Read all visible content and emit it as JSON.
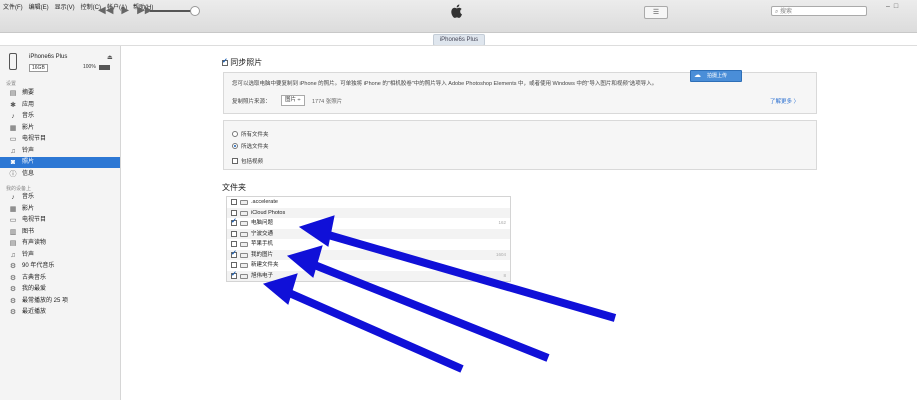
{
  "menu": [
    "文件(F)",
    "编辑(E)",
    "显示(V)",
    "控制(C)",
    "帐户(A)",
    "帮助(H)"
  ],
  "search": {
    "placeholder": "搜索"
  },
  "device_tab": "iPhone6s Plus",
  "device": {
    "name": "iPhone6s Plus",
    "capacity": "16GB",
    "battery": "100%"
  },
  "sidebar": {
    "section1": "设置",
    "items1": [
      {
        "label": "摘要",
        "icon": "summary-icon"
      },
      {
        "label": "应用",
        "icon": "apps-icon"
      },
      {
        "label": "音乐",
        "icon": "music-icon"
      },
      {
        "label": "影片",
        "icon": "movies-icon"
      },
      {
        "label": "电视节目",
        "icon": "tv-icon"
      },
      {
        "label": "铃声",
        "icon": "bell-icon"
      },
      {
        "label": "照片",
        "icon": "camera-icon",
        "selected": true
      },
      {
        "label": "信息",
        "icon": "info-icon"
      }
    ],
    "section2": "我的设备上",
    "items2": [
      {
        "label": "音乐",
        "icon": "music-icon"
      },
      {
        "label": "影片",
        "icon": "movies-icon"
      },
      {
        "label": "电视节目",
        "icon": "tv-icon"
      },
      {
        "label": "图书",
        "icon": "book-icon"
      },
      {
        "label": "有声读物",
        "icon": "audiobook-icon"
      },
      {
        "label": "铃声",
        "icon": "bell-icon"
      },
      {
        "label": "90 年代音乐",
        "icon": "gear-icon"
      },
      {
        "label": "古典音乐",
        "icon": "gear-icon"
      },
      {
        "label": "我的最爱",
        "icon": "gear-icon"
      },
      {
        "label": "最常播放的 25 项",
        "icon": "gear-icon"
      },
      {
        "label": "最近播放",
        "icon": "gear-icon"
      }
    ]
  },
  "sync": {
    "title": "同步照片",
    "checked": true,
    "description": "您可以选取电脑中要复制到 iPhone 的照片。可单独将 iPhone 的\"相机胶卷\"中的照片导入 Adobe Photoshop Elements 中，或者使用 Windows 中的\"导入图片和视频\"选项导入。",
    "source_label": "复制照片来源：",
    "source_value": "图片 ÷",
    "source_count": "1774 张照片",
    "learn_more": "了解更多 〉"
  },
  "options": {
    "all_folders": "所有文件夹",
    "selected_folders": "所选文件夹",
    "include_videos": "包括视频"
  },
  "folders": {
    "title": "文件夹",
    "rows": [
      {
        "name": ".accelerate",
        "checked": false,
        "count": ""
      },
      {
        "name": "iCloud Photos",
        "checked": false,
        "count": ""
      },
      {
        "name": "电脑问题",
        "checked": true,
        "count": "162"
      },
      {
        "name": "宁波交通",
        "checked": false,
        "count": ""
      },
      {
        "name": "苹果手机",
        "checked": false,
        "count": ""
      },
      {
        "name": "我的图片",
        "checked": true,
        "count": "1604"
      },
      {
        "name": "新建文件夹",
        "checked": false,
        "count": ""
      },
      {
        "name": "旭伟电子",
        "checked": true,
        "count": "8"
      }
    ]
  },
  "badge": "拍摄上传",
  "colors": {
    "accent": "#2c77d4",
    "arrow": "#1010d8"
  }
}
